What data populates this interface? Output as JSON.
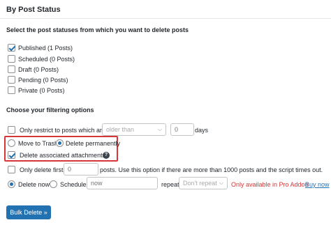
{
  "panel": {
    "title": "By Post Status"
  },
  "intro": "Select the post statuses from which you want to delete posts",
  "statuses": [
    {
      "label": "Published (1 Posts)",
      "checked": true
    },
    {
      "label": "Scheduled (0 Posts)",
      "checked": false
    },
    {
      "label": "Draft (0 Posts)",
      "checked": false
    },
    {
      "label": "Pending (0 Posts)",
      "checked": false
    },
    {
      "label": "Private (0 Posts)",
      "checked": false
    }
  ],
  "filtering": {
    "heading": "Choose your filtering options",
    "restrict_label": "Only restrict to posts which are",
    "restrict_select_value": "older than",
    "restrict_days_placeholder": "0",
    "days_label": "days",
    "move_to_trash": "Move to Trash",
    "delete_permanently": "Delete permanently",
    "delete_attachments": "Delete associated attachments",
    "help_icon": "?",
    "delete_first_label": "Only delete first",
    "delete_first_placeholder": "0",
    "delete_first_suffix": "posts. Use this option if there are more than 1000 posts and the script times out.",
    "delete_now": "Delete now",
    "schedule": "Schedule",
    "schedule_time_placeholder": "now",
    "repeat_label": "repeat",
    "repeat_value": "Don't repeat",
    "pro_notice": "Only available in Pro Addon",
    "buy_now": "Buy now"
  },
  "actions": {
    "bulk_delete": "Bulk Delete »"
  },
  "colors": {
    "accent": "#2271b1",
    "highlight_border": "#d63638",
    "pro_text": "#d63638"
  }
}
